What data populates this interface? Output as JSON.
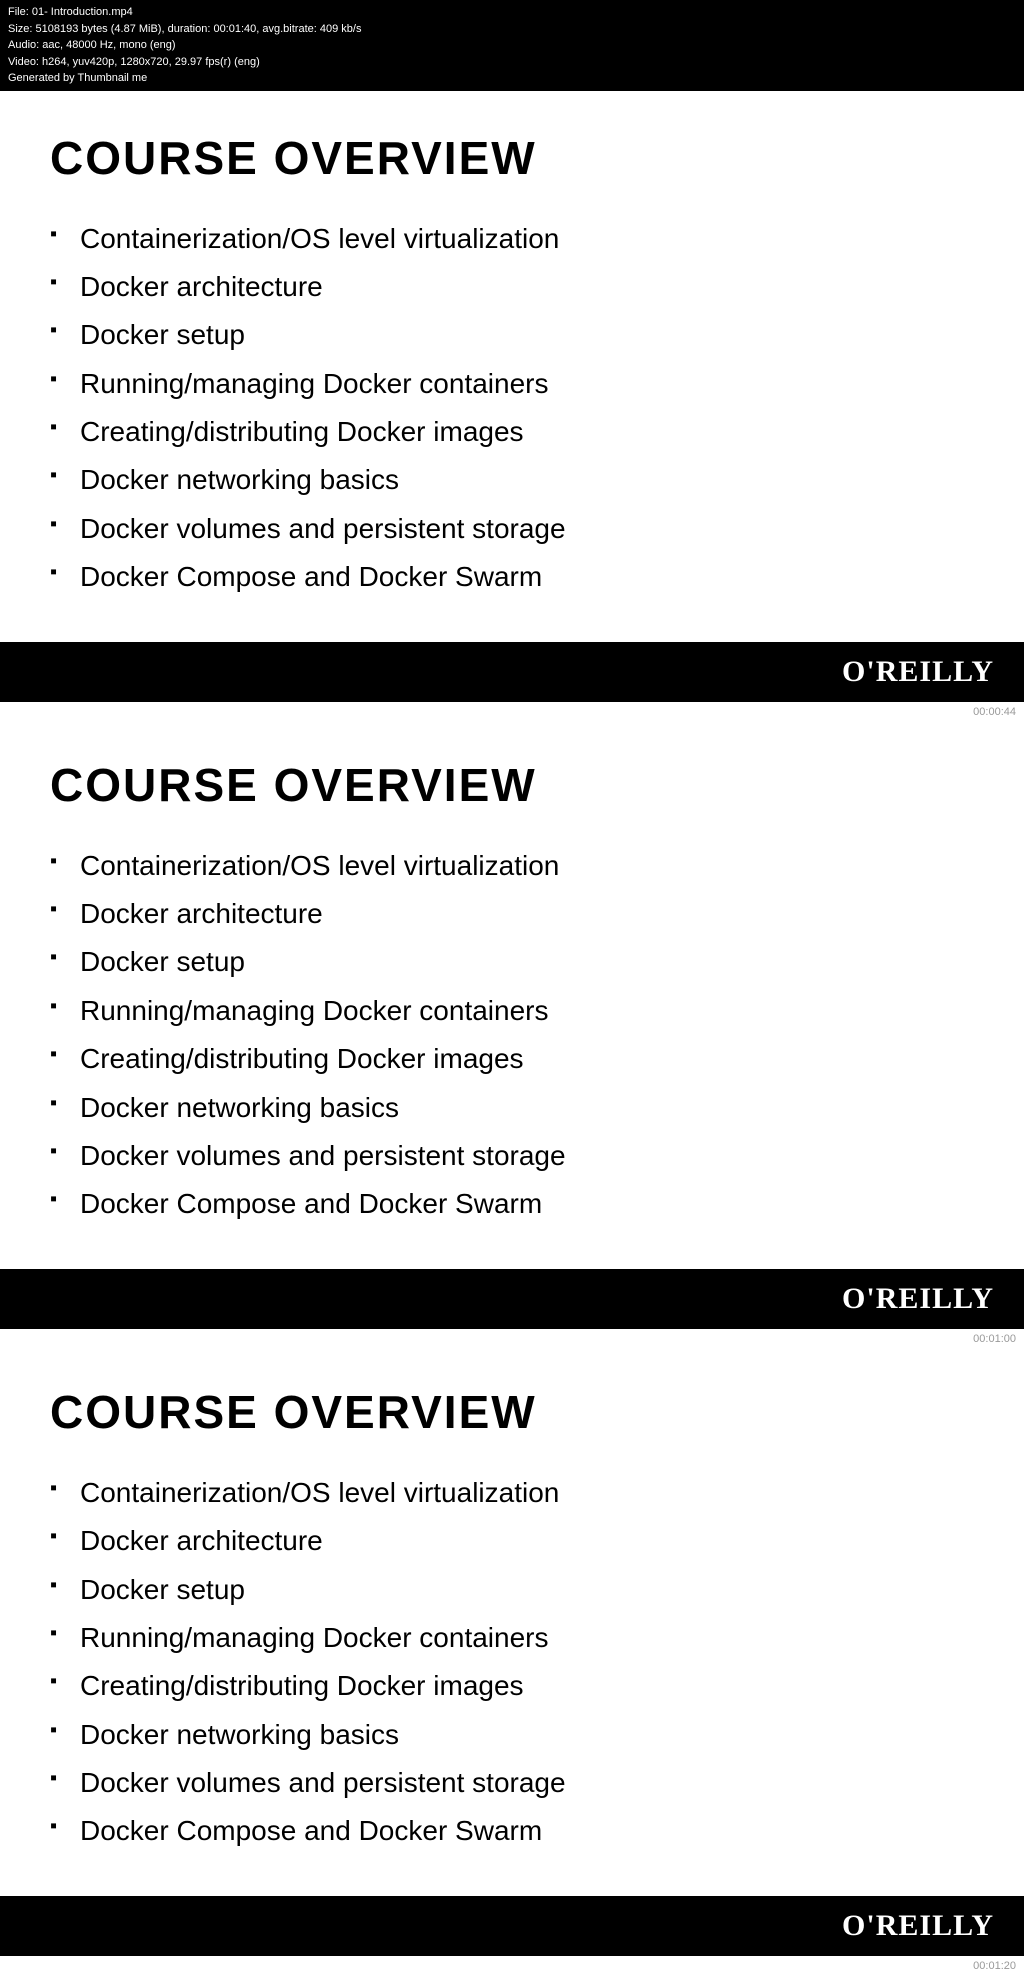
{
  "metadata": {
    "line1": "File: 01- Introduction.mp4",
    "line2": "Size: 5108193 bytes (4.87 MiB), duration: 00:01:40, avg.bitrate: 409 kb/s",
    "line3": "Audio: aac, 48000 Hz, mono (eng)",
    "line4": "Video: h264, yuv420p, 1280x720, 29.97 fps(r) (eng)",
    "line5": "Generated by Thumbnail me"
  },
  "slides": [
    {
      "title": "COURSE OVERVIEW",
      "timestamp": "00:00:44",
      "items": [
        "Containerization/OS level virtualization",
        "Docker architecture",
        "Docker setup",
        "Running/managing Docker containers",
        "Creating/distributing Docker images",
        "Docker networking basics",
        "Docker volumes and persistent storage",
        "Docker Compose and Docker Swarm"
      ]
    },
    {
      "title": "COURSE OVERVIEW",
      "timestamp": "00:01:00",
      "items": [
        "Containerization/OS level virtualization",
        "Docker architecture",
        "Docker setup",
        "Running/managing Docker containers",
        "Creating/distributing Docker images",
        "Docker networking basics",
        "Docker volumes and persistent storage",
        "Docker Compose and Docker Swarm"
      ]
    },
    {
      "title": "COURSE OVERVIEW",
      "timestamp": "00:01:20",
      "items": [
        "Containerization/OS level virtualization",
        "Docker architecture",
        "Docker setup",
        "Running/managing Docker containers",
        "Creating/distributing Docker images",
        "Docker networking basics",
        "Docker volumes and persistent storage",
        "Docker Compose and Docker Swarm"
      ]
    }
  ],
  "oreilly_brand": "O'REILLY"
}
